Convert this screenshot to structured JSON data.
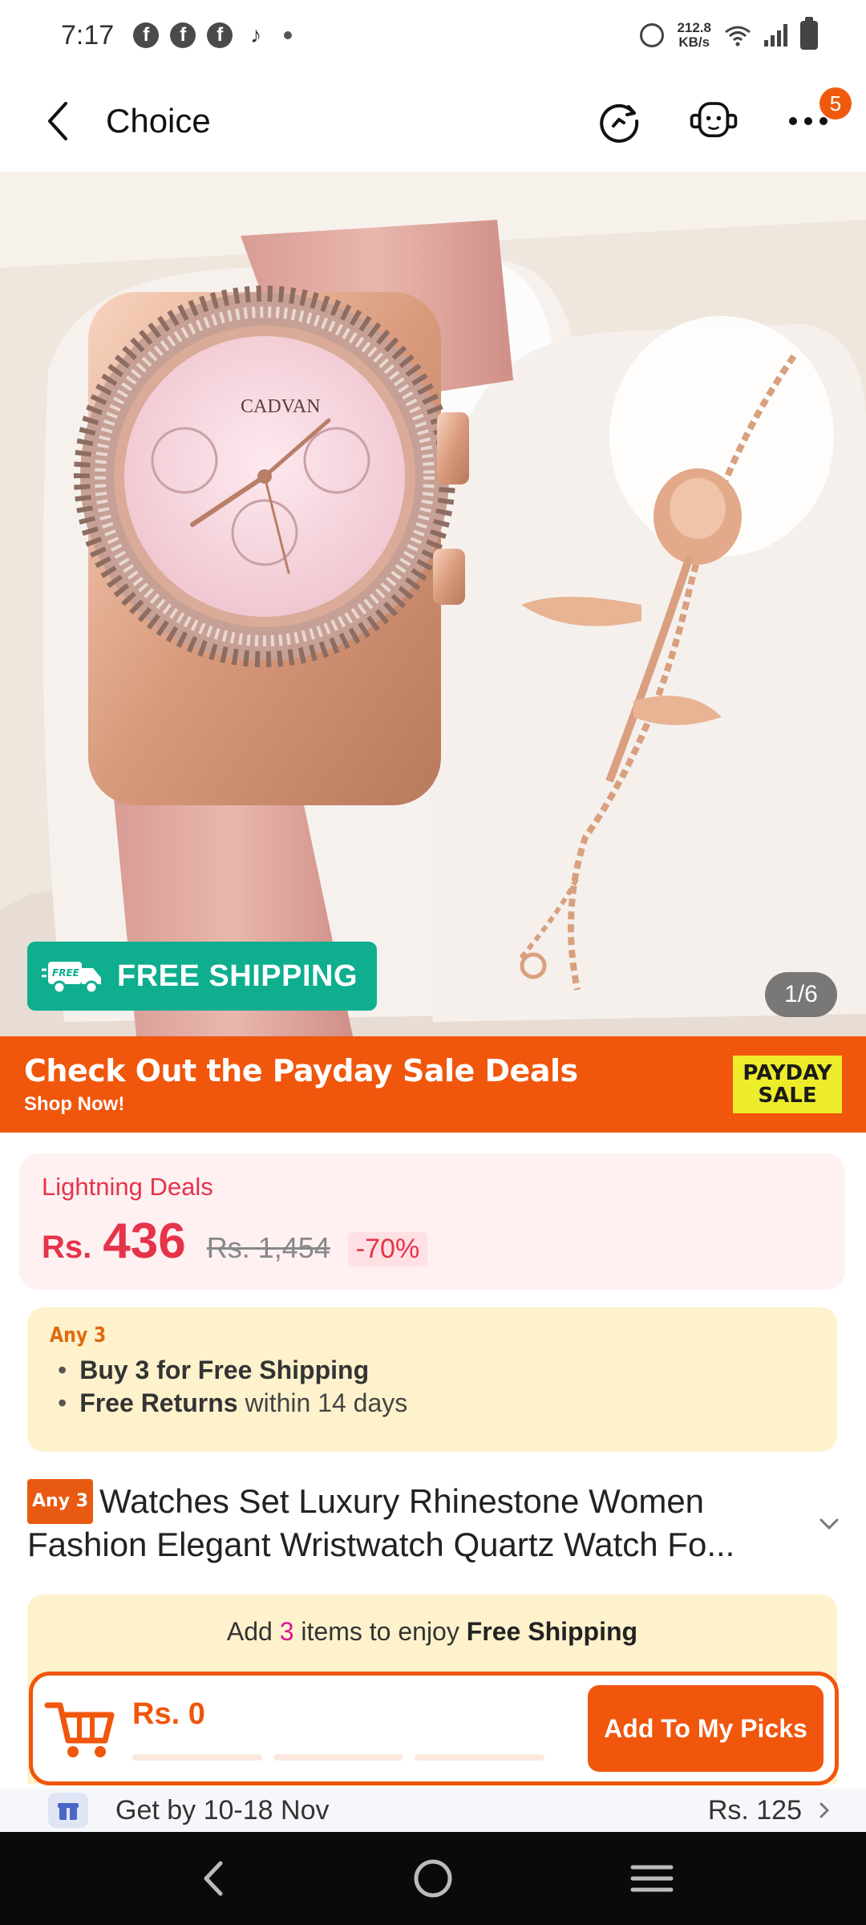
{
  "status_bar": {
    "time": "7:17",
    "fb_icon": "f",
    "net_speed_value": "212.8",
    "net_speed_unit": "KB/s"
  },
  "header": {
    "title": "Choice",
    "menu_badge": "5"
  },
  "hero": {
    "free_shipping_label": "FREE SHIPPING",
    "image_counter": "1/6",
    "image_subject": "rose gold rhinestone watch and rose bracelet set"
  },
  "payday_banner": {
    "headline": "Check Out the Payday Sale Deals",
    "cta": "Shop Now!",
    "tag_line1": "PAYDAY",
    "tag_line2": "SALE"
  },
  "deals": {
    "title": "Lightning Deals",
    "currency": "Rs.",
    "price": "436",
    "original_price": "Rs. 1,454",
    "discount": "-70%"
  },
  "any3": {
    "tag": "Any 3",
    "item1_bold": "Buy 3 for  Free Shipping",
    "item2_bold": "Free Returns",
    "item2_rest": " within 14 days"
  },
  "product": {
    "tag": "Any 3",
    "title": "Watches Set Luxury Rhinestone Women Fashion Elegant Wristwatch Quartz Watch Fo..."
  },
  "add_panel": {
    "msg_pre": "Add ",
    "msg_num": "3",
    "msg_mid": " items to enjoy ",
    "msg_bold": "Free Shipping",
    "picks_price": "Rs. 0",
    "button_label": "Add To My Picks"
  },
  "delivery": {
    "text": "Get by 10-18 Nov",
    "price": "Rs. 125"
  },
  "colors": {
    "accent": "#f0560c",
    "deal_red": "#e5344a",
    "free_ship_green": "#0eae8f"
  }
}
